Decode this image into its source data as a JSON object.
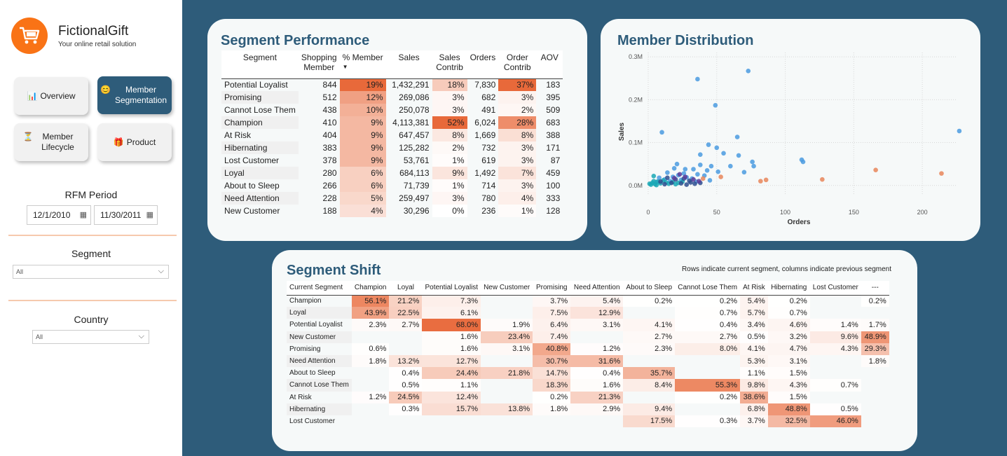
{
  "app": {
    "brand": "FictionalGift",
    "tagline": "Your online retail solution"
  },
  "nav": [
    {
      "label": "Overview",
      "icon": "📊"
    },
    {
      "label": "Member Segmentation",
      "icon": "😊"
    },
    {
      "label": "Member Lifecycle",
      "icon": "⏳"
    },
    {
      "label": "Product",
      "icon": "🎁"
    }
  ],
  "rfm": {
    "label": "RFM Period",
    "start": "12/1/2010",
    "end": "11/30/2011"
  },
  "segment_slicer": {
    "label": "Segment",
    "value": "All"
  },
  "country_slicer": {
    "label": "Country",
    "value": "All"
  },
  "colors": {
    "accent": "#2e5c7a",
    "brand_orange": "#f97316",
    "heat": "#e8693a"
  },
  "performance": {
    "title": "Segment Performance",
    "columns": [
      "Segment",
      "Shopping Member",
      "% Member",
      "Sales",
      "Sales Contrib",
      "Orders",
      "Order Contrib",
      "AOV"
    ],
    "sort_indicator": "▼",
    "rows": [
      [
        "Potential Loyalist",
        "844",
        "19%",
        "1,432,291",
        "18%",
        "7,830",
        "37%",
        "183"
      ],
      [
        "Promising",
        "512",
        "12%",
        "269,086",
        "3%",
        "682",
        "3%",
        "395"
      ],
      [
        "Cannot Lose Them",
        "438",
        "10%",
        "250,078",
        "3%",
        "491",
        "2%",
        "509"
      ],
      [
        "Champion",
        "410",
        "9%",
        "4,113,381",
        "52%",
        "6,024",
        "28%",
        "683"
      ],
      [
        "At Risk",
        "404",
        "9%",
        "647,457",
        "8%",
        "1,669",
        "8%",
        "388"
      ],
      [
        "Hibernating",
        "383",
        "9%",
        "125,282",
        "2%",
        "732",
        "3%",
        "171"
      ],
      [
        "Lost Customer",
        "378",
        "9%",
        "53,761",
        "1%",
        "619",
        "3%",
        "87"
      ],
      [
        "Loyal",
        "280",
        "6%",
        "684,113",
        "9%",
        "1,492",
        "7%",
        "459"
      ],
      [
        "About to Sleep",
        "266",
        "6%",
        "71,739",
        "1%",
        "714",
        "3%",
        "100"
      ],
      [
        "Need Attention",
        "228",
        "5%",
        "259,497",
        "3%",
        "780",
        "4%",
        "333"
      ],
      [
        "New Customer",
        "188",
        "4%",
        "30,296",
        "0%",
        "236",
        "1%",
        "128"
      ]
    ]
  },
  "distribution": {
    "title": "Member Distribution",
    "chart_data": {
      "type": "scatter",
      "xlabel": "Orders",
      "ylabel": "Sales",
      "xlim": [
        0,
        225
      ],
      "ylim": [
        -20000,
        310000
      ],
      "x_ticks": [
        "0",
        "50",
        "100",
        "150",
        "200"
      ],
      "y_ticks": [
        "0.0M",
        "0.1M",
        "0.2M",
        "0.3M"
      ],
      "grid": true,
      "series": [
        {
          "color": "#4a9be0",
          "points": [
            [
              10,
              124000
            ],
            [
              36,
              248000
            ],
            [
              49,
              187000
            ],
            [
              73,
              267000
            ],
            [
              65,
              113000
            ],
            [
              227,
              127000
            ],
            [
              44,
              95000
            ],
            [
              50,
              88000
            ],
            [
              55,
              75000
            ],
            [
              38,
              72000
            ],
            [
              66,
              70000
            ],
            [
              112,
              60000
            ],
            [
              76,
              55000
            ],
            [
              113,
              55000
            ],
            [
              21,
              50000
            ],
            [
              38,
              48000
            ],
            [
              46,
              45000
            ],
            [
              60,
              45000
            ],
            [
              77,
              45000
            ],
            [
              19,
              40000
            ],
            [
              27,
              38000
            ],
            [
              33,
              38000
            ],
            [
              43,
              35000
            ],
            [
              51,
              32000
            ],
            [
              70,
              31000
            ],
            [
              14,
              30000
            ],
            [
              26,
              28000
            ],
            [
              36,
              26000
            ],
            [
              22,
              24000
            ],
            [
              41,
              23000
            ],
            [
              18,
              20000
            ],
            [
              28,
              19000
            ],
            [
              8,
              18000
            ],
            [
              32,
              16000
            ],
            [
              12,
              14000
            ],
            [
              24,
              13000
            ],
            [
              45,
              12000
            ],
            [
              16,
              10000
            ],
            [
              35,
              9000
            ],
            [
              6,
              8000
            ]
          ]
        },
        {
          "color": "#e8865b",
          "points": [
            [
              166,
              36000
            ],
            [
              214,
              28000
            ],
            [
              86,
              13000
            ],
            [
              82,
              10000
            ],
            [
              127,
              14000
            ],
            [
              53,
              20000
            ],
            [
              40,
              16000
            ]
          ]
        },
        {
          "color": "#1aa8b5",
          "points": [
            [
              1,
              4000
            ],
            [
              3,
              6000
            ],
            [
              5,
              3000
            ],
            [
              7,
              9000
            ],
            [
              9,
              5000
            ],
            [
              11,
              12000
            ],
            [
              13,
              7000
            ],
            [
              15,
              4000
            ],
            [
              18,
              8000
            ],
            [
              20,
              3000
            ],
            [
              2,
              2000
            ],
            [
              4,
              10000
            ],
            [
              6,
              1000
            ],
            [
              22,
              6000
            ],
            [
              25,
              9000
            ],
            [
              4,
              22000
            ]
          ]
        },
        {
          "color": "#2f4f8f",
          "points": [
            [
              14,
              18000
            ],
            [
              20,
              14000
            ],
            [
              26,
              16000
            ],
            [
              30,
              11000
            ],
            [
              17,
              6000
            ],
            [
              24,
              5000
            ],
            [
              31,
              7000
            ],
            [
              34,
              4000
            ],
            [
              38,
              6000
            ],
            [
              28,
              2000
            ],
            [
              12,
              3000
            ],
            [
              9,
              9000
            ]
          ]
        },
        {
          "color": "#5e3c99",
          "points": [
            [
              23,
              26000
            ],
            [
              27,
              20000
            ],
            [
              33,
              14000
            ],
            [
              19,
              17000
            ],
            [
              37,
              10000
            ]
          ]
        }
      ]
    }
  },
  "shift": {
    "title": "Segment Shift",
    "note": "Rows indicate current segment, columns indicate previous segment",
    "columns": [
      "Current Segment",
      "Champion",
      "Loyal",
      "Potential Loyalist",
      "New Customer",
      "Promising",
      "Need Attention",
      "About to Sleep",
      "Cannot Lose Them",
      "At Risk",
      "Hibernating",
      "Lost Customer",
      "---"
    ],
    "rows": [
      [
        "Champion",
        "56.1%",
        "21.2%",
        "7.3%",
        "",
        "3.7%",
        "5.4%",
        "0.2%",
        "0.2%",
        "5.4%",
        "0.2%",
        "",
        "0.2%"
      ],
      [
        "Loyal",
        "43.9%",
        "22.5%",
        "6.1%",
        "",
        "7.5%",
        "12.9%",
        "",
        "0.7%",
        "5.7%",
        "0.7%",
        "",
        ""
      ],
      [
        "Potential Loyalist",
        "2.3%",
        "2.7%",
        "68.0%",
        "1.9%",
        "6.4%",
        "3.1%",
        "4.1%",
        "0.4%",
        "3.4%",
        "4.6%",
        "1.4%",
        "1.7%"
      ],
      [
        "New Customer",
        "",
        "",
        "1.6%",
        "23.4%",
        "7.4%",
        "",
        "2.7%",
        "2.7%",
        "0.5%",
        "3.2%",
        "9.6%",
        "48.9%"
      ],
      [
        "Promising",
        "0.6%",
        "",
        "1.6%",
        "3.1%",
        "40.8%",
        "1.2%",
        "2.3%",
        "8.0%",
        "4.1%",
        "4.7%",
        "4.3%",
        "29.3%"
      ],
      [
        "Need Attention",
        "1.8%",
        "13.2%",
        "12.7%",
        "",
        "30.7%",
        "31.6%",
        "",
        "",
        "5.3%",
        "3.1%",
        "",
        "1.8%"
      ],
      [
        "About to Sleep",
        "",
        "0.4%",
        "24.4%",
        "21.8%",
        "14.7%",
        "0.4%",
        "35.7%",
        "",
        "1.1%",
        "1.5%",
        "",
        ""
      ],
      [
        "Cannot Lose Them",
        "",
        "0.5%",
        "1.1%",
        "",
        "18.3%",
        "1.6%",
        "8.4%",
        "55.3%",
        "9.8%",
        "4.3%",
        "0.7%",
        ""
      ],
      [
        "At Risk",
        "1.2%",
        "24.5%",
        "12.4%",
        "",
        "0.2%",
        "21.3%",
        "",
        "0.2%",
        "38.6%",
        "1.5%",
        "",
        ""
      ],
      [
        "Hibernating",
        "",
        "0.3%",
        "15.7%",
        "13.8%",
        "1.8%",
        "2.9%",
        "9.4%",
        "",
        "6.8%",
        "48.8%",
        "0.5%",
        ""
      ],
      [
        "Lost Customer",
        "",
        "",
        "",
        "",
        "",
        "",
        "17.5%",
        "0.3%",
        "3.7%",
        "32.5%",
        "46.0%",
        ""
      ]
    ]
  }
}
